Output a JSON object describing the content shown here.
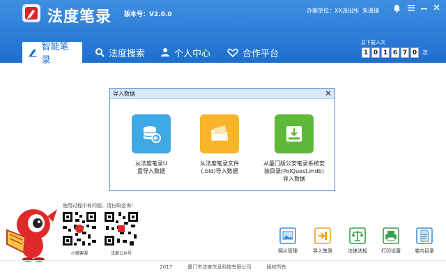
{
  "app": {
    "title": "法度笔录",
    "version": "版本号：V2.0.0",
    "unit": "办案单位：XX派出所",
    "user": "朱珊珊"
  },
  "tabs": [
    {
      "label": "智能笔录",
      "icon": "pen-icon",
      "active": true
    },
    {
      "label": "法度搜索",
      "icon": "search-icon",
      "active": false
    },
    {
      "label": "个人中心",
      "icon": "person-icon",
      "active": false
    },
    {
      "label": "合作平台",
      "icon": "handshake-icon",
      "active": false
    }
  ],
  "downloads": {
    "label": "总下载人次",
    "digits": [
      "1",
      "0",
      "1",
      "6",
      "7",
      "0"
    ],
    "unit": "次"
  },
  "dialog": {
    "title": "导入数据",
    "options": [
      {
        "lines": [
          "从法度笔录U",
          "盘导入数据"
        ],
        "color": "#3fa9e6",
        "icon": "usb-database-icon"
      },
      {
        "lines": [
          "从法度笔录文件",
          "(.bld)导入数据"
        ],
        "color": "#f7b52c",
        "icon": "folder-icon"
      },
      {
        "lines": [
          "从厦门版公安笔录系统安",
          "装目录(PolQuest.mdb)",
          "导入数据"
        ],
        "color": "#5fb83a",
        "icon": "hdd-download-icon"
      }
    ]
  },
  "help": {
    "text": "使用过程中有问题，请扫码咨询！",
    "qr": [
      {
        "label": "小度客服"
      },
      {
        "label": "法度公众号"
      }
    ]
  },
  "tools": [
    {
      "label": "照片管理",
      "icon": "photo-icon",
      "color": "#3d8fd9"
    },
    {
      "label": "导入笔录",
      "icon": "import-icon",
      "color": "#f0a020"
    },
    {
      "label": "法律法规",
      "icon": "scale-icon",
      "color": "#3aa050"
    },
    {
      "label": "打印设置",
      "icon": "printer-icon",
      "color": "#3aa050"
    },
    {
      "label": "卷内目录",
      "icon": "document-icon",
      "color": "#3d8fd9"
    }
  ],
  "footer": {
    "year": "2017",
    "company": "厦门市法度信息科技有限公司",
    "rights": "版权所有"
  }
}
